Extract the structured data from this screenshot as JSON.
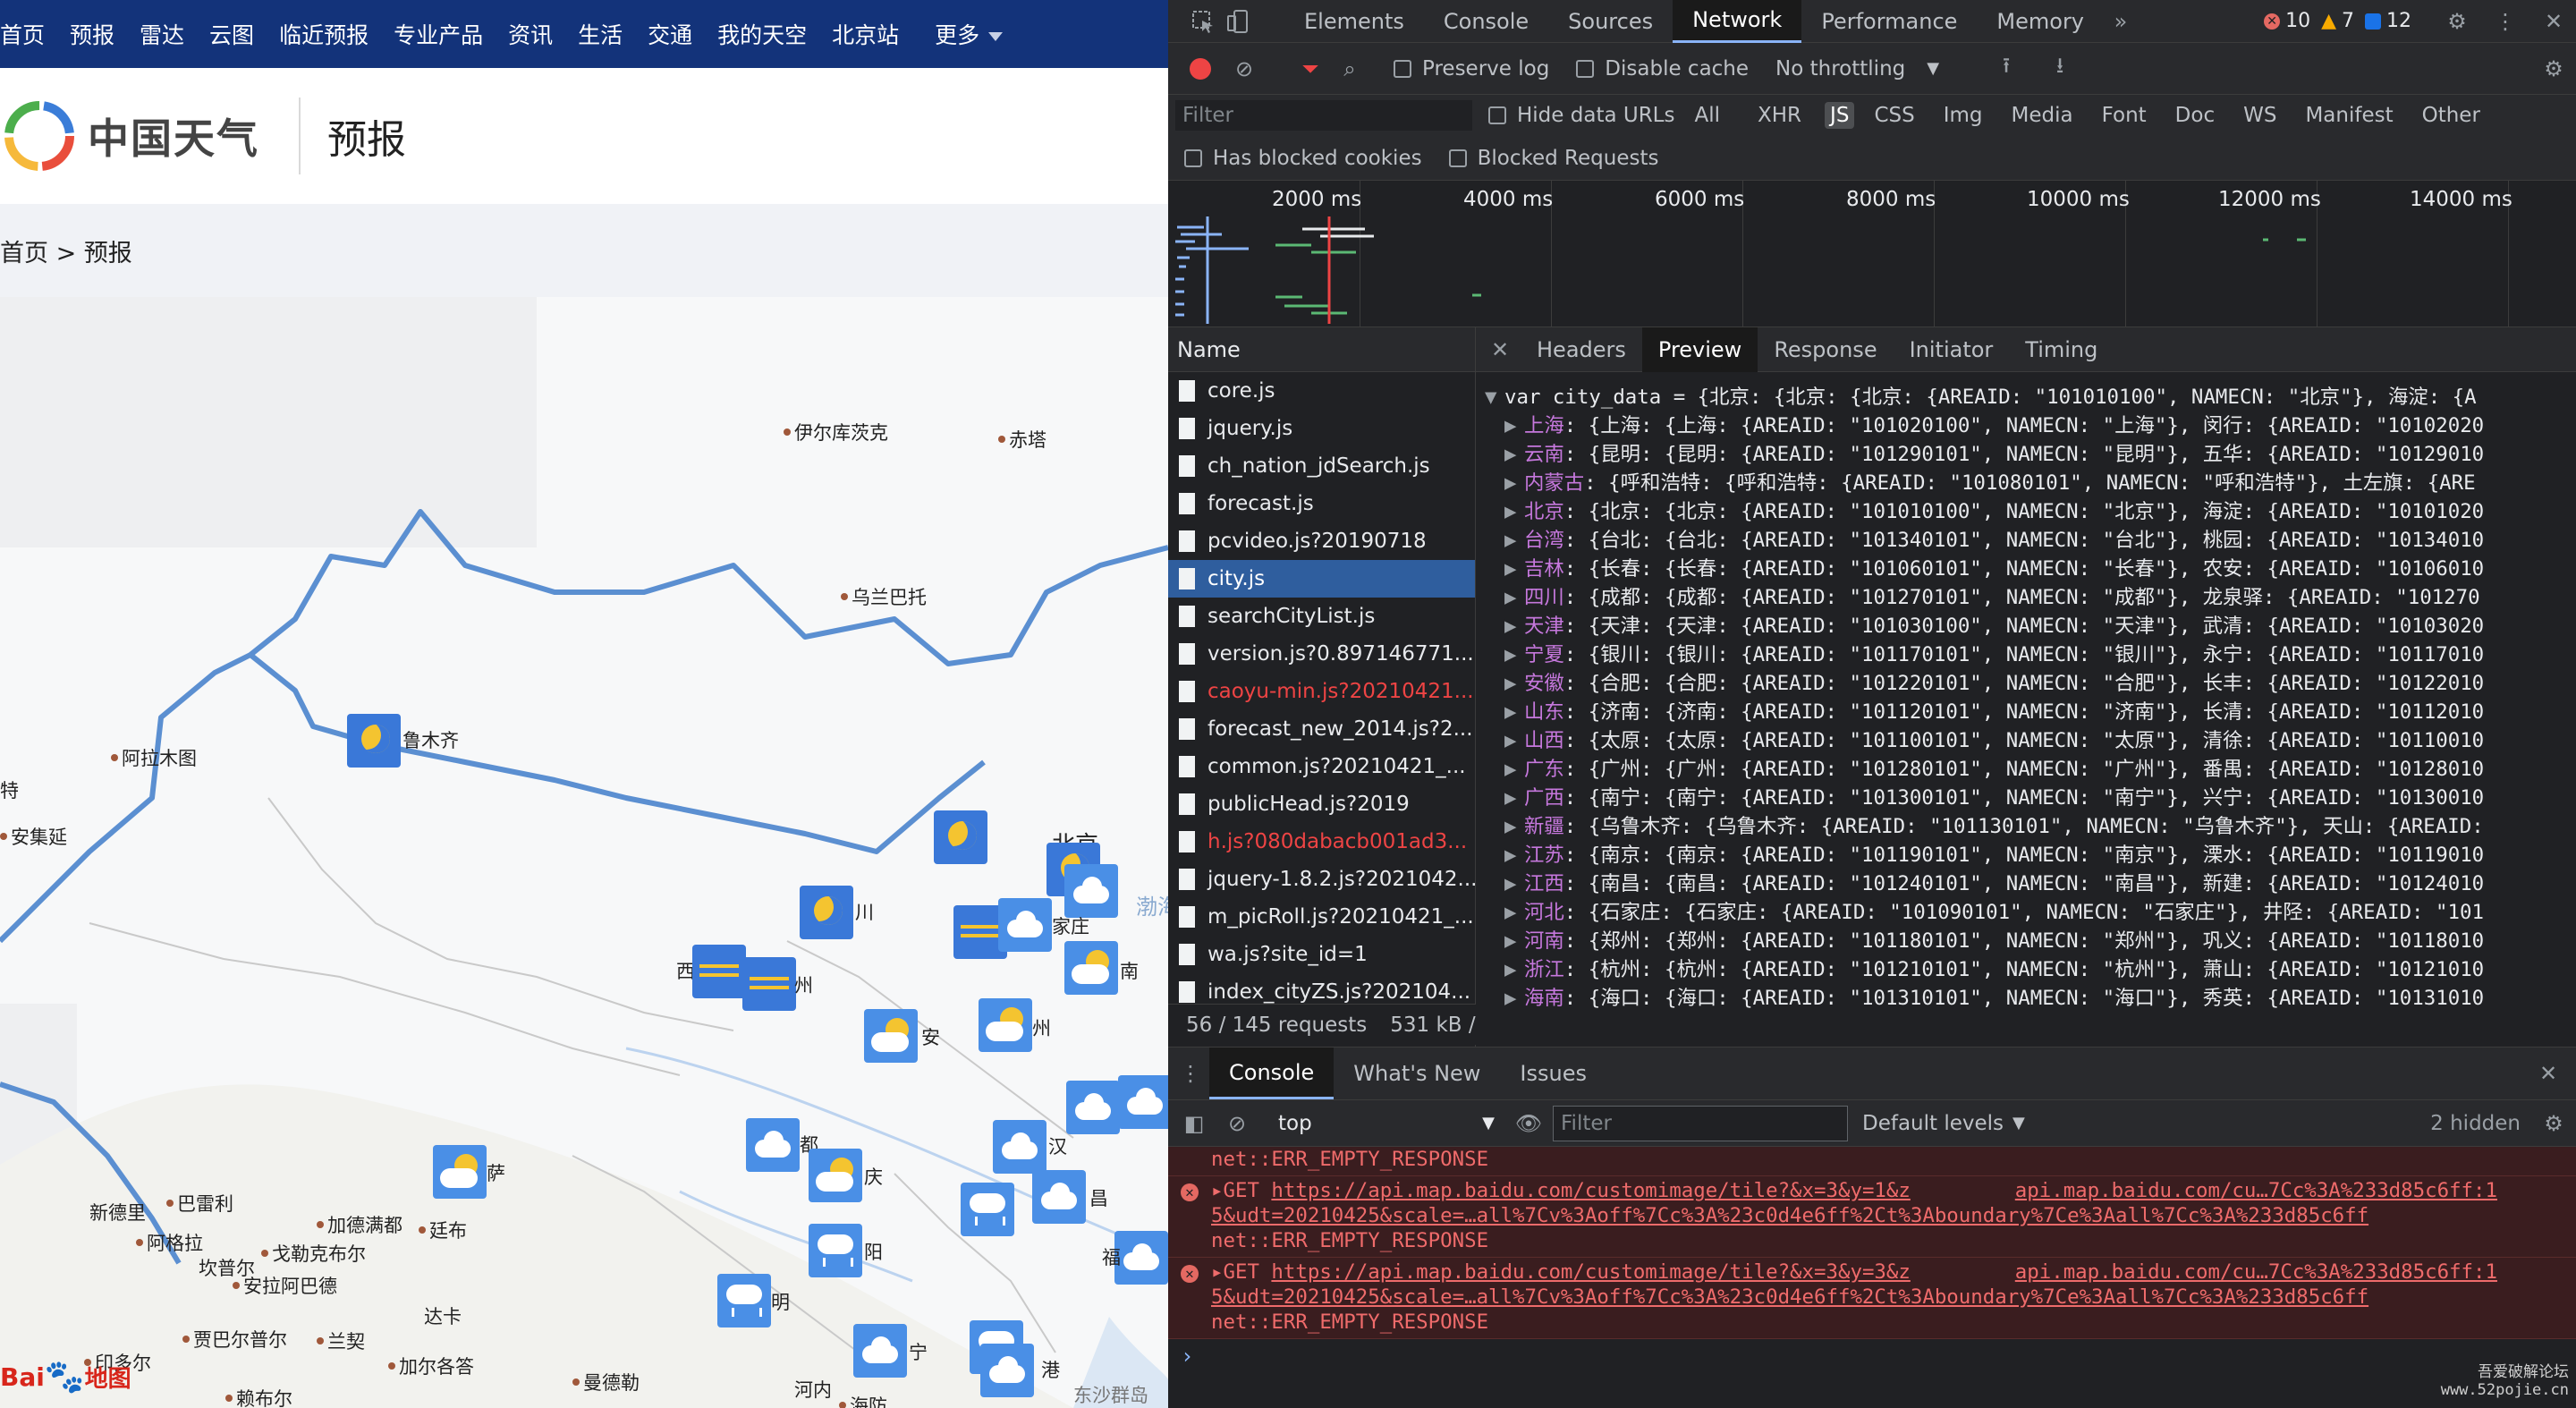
{
  "site": {
    "nav": [
      "首页",
      "预报",
      "雷达",
      "云图",
      "临近预报",
      "专业产品",
      "资讯",
      "生活",
      "交通",
      "我的天空",
      "北京站",
      "更多"
    ],
    "logo_text": "中国天气",
    "section": "预报",
    "breadcrumb": "首页 > 预报",
    "cities": [
      {
        "name": "伊尔库茨克",
        "icon": null
      },
      {
        "name": "赤塔",
        "icon": null
      },
      {
        "name": "乌兰巴托",
        "icon": null
      },
      {
        "name": "鲁木齐",
        "icon": "night"
      },
      {
        "name": "阿拉木图",
        "icon": null
      },
      {
        "name": "特",
        "icon": null
      },
      {
        "name": "安集延",
        "icon": null
      },
      {
        "name": "北京",
        "icon": "night"
      },
      {
        "name": "川",
        "icon": "night"
      },
      {
        "name": "家庄",
        "icon": "cloud"
      },
      {
        "name": "南",
        "icon": "sunc"
      },
      {
        "name": "西",
        "icon": "wind"
      },
      {
        "name": "州",
        "icon": "wind"
      },
      {
        "name": "安",
        "icon": "sunc"
      },
      {
        "name": "州",
        "icon": "sunc"
      },
      {
        "name": "萨",
        "icon": "sunc"
      },
      {
        "name": "都",
        "icon": "cloud"
      },
      {
        "name": "庆",
        "icon": "sunc"
      },
      {
        "name": "汉",
        "icon": "cloud"
      },
      {
        "name": "昌",
        "icon": "cloud"
      },
      {
        "name": "阳",
        "icon": "rain"
      },
      {
        "name": "明",
        "icon": "rain"
      },
      {
        "name": "宁",
        "icon": "cloud"
      },
      {
        "name": "港",
        "icon": "rain"
      },
      {
        "name": "福",
        "icon": "cloud"
      },
      {
        "name": "新德里",
        "icon": null
      },
      {
        "name": "巴雷利",
        "icon": null
      },
      {
        "name": "加德满都",
        "icon": null
      },
      {
        "name": "廷布",
        "icon": null
      },
      {
        "name": "阿格拉",
        "icon": null
      },
      {
        "name": "坎普尔",
        "icon": null
      },
      {
        "name": "戈勒克布尔",
        "icon": null
      },
      {
        "name": "安拉阿巴德",
        "icon": null
      },
      {
        "name": "达卡",
        "icon": null
      },
      {
        "name": "贾巴尔普尔",
        "icon": null
      },
      {
        "name": "兰契",
        "icon": null
      },
      {
        "name": "印多尔",
        "icon": null
      },
      {
        "name": "加尔各答",
        "icon": null
      },
      {
        "name": "曼德勒",
        "icon": null
      },
      {
        "name": "河内",
        "icon": null
      },
      {
        "name": "赖布尔",
        "icon": null
      },
      {
        "name": "海防",
        "icon": null
      },
      {
        "name": "东沙群岛",
        "icon": null
      },
      {
        "name": "渤海",
        "icon": null
      }
    ],
    "baidu_logo": "Bai",
    "baidu_logo2": "地图"
  },
  "devtools": {
    "tabs": [
      "Elements",
      "Console",
      "Sources",
      "Network",
      "Performance",
      "Memory"
    ],
    "active_tab": "Network",
    "errors": "10",
    "warnings": "7",
    "messages": "12",
    "toolbar": {
      "preserve_log": "Preserve log",
      "disable_cache": "Disable cache",
      "throttling": "No throttling"
    },
    "filter": {
      "placeholder": "Filter",
      "hide_data_urls": "Hide data URLs",
      "types": [
        "All",
        "XHR",
        "JS",
        "CSS",
        "Img",
        "Media",
        "Font",
        "Doc",
        "WS",
        "Manifest",
        "Other"
      ],
      "active_type": "JS",
      "has_blocked_cookies": "Has blocked cookies",
      "blocked_requests": "Blocked Requests"
    },
    "timeline_labels": [
      "2000 ms",
      "4000 ms",
      "6000 ms",
      "8000 ms",
      "10000 ms",
      "12000 ms",
      "14000 ms"
    ],
    "requests_header": "Name",
    "requests": [
      {
        "name": "core.js",
        "state": "normal"
      },
      {
        "name": "jquery.js",
        "state": "normal"
      },
      {
        "name": "ch_nation_jdSearch.js",
        "state": "normal"
      },
      {
        "name": "forecast.js",
        "state": "normal"
      },
      {
        "name": "pcvideo.js?20190718",
        "state": "normal"
      },
      {
        "name": "city.js",
        "state": "selected"
      },
      {
        "name": "searchCityList.js",
        "state": "normal"
      },
      {
        "name": "version.js?0.897146771...",
        "state": "normal"
      },
      {
        "name": "caoyu-min.js?20210421...",
        "state": "error"
      },
      {
        "name": "forecast_new_2014.js?2...",
        "state": "normal"
      },
      {
        "name": "common.js?20210421_...",
        "state": "normal"
      },
      {
        "name": "publicHead.js?2019",
        "state": "normal"
      },
      {
        "name": "h.js?080dabacb001ad3...",
        "state": "error"
      },
      {
        "name": "jquery-1.8.2.js?2021042...",
        "state": "normal"
      },
      {
        "name": "m_picRoll.js?20210421_...",
        "state": "normal"
      },
      {
        "name": "wa.js?site_id=1",
        "state": "normal"
      },
      {
        "name": "index_cityZS.js?202104...",
        "state": "normal"
      }
    ],
    "requests_status": "56 / 145 requests",
    "transferred": "531 kB /",
    "preview_tabs": [
      "Headers",
      "Preview",
      "Response",
      "Initiator",
      "Timing"
    ],
    "active_preview_tab": "Preview",
    "preview_first_line": "var city_data = {北京: {北京: {北京: {AREAID: \"101010100\", NAMECN: \"北京\"}, 海淀: {A",
    "preview_rows": [
      {
        "key": "上海",
        "rest": ": {上海: {上海: {AREAID: \"101020100\", NAMECN: \"上海\"}, 闵行: {AREAID: \"10102020"
      },
      {
        "key": "云南",
        "rest": ": {昆明: {昆明: {AREAID: \"101290101\", NAMECN: \"昆明\"}, 五华: {AREAID: \"10129010"
      },
      {
        "key": "内蒙古",
        "rest": ": {呼和浩特: {呼和浩特: {AREAID: \"101080101\", NAMECN: \"呼和浩特\"}, 土左旗: {ARE"
      },
      {
        "key": "北京",
        "rest": ": {北京: {北京: {AREAID: \"101010100\", NAMECN: \"北京\"}, 海淀: {AREAID: \"10101020"
      },
      {
        "key": "台湾",
        "rest": ": {台北: {台北: {AREAID: \"101340101\", NAMECN: \"台北\"}, 桃园: {AREAID: \"10134010"
      },
      {
        "key": "吉林",
        "rest": ": {长春: {长春: {AREAID: \"101060101\", NAMECN: \"长春\"}, 农安: {AREAID: \"10106010"
      },
      {
        "key": "四川",
        "rest": ": {成都: {成都: {AREAID: \"101270101\", NAMECN: \"成都\"}, 龙泉驿: {AREAID: \"101270"
      },
      {
        "key": "天津",
        "rest": ": {天津: {天津: {AREAID: \"101030100\", NAMECN: \"天津\"}, 武清: {AREAID: \"10103020"
      },
      {
        "key": "宁夏",
        "rest": ": {银川: {银川: {AREAID: \"101170101\", NAMECN: \"银川\"}, 永宁: {AREAID: \"10117010"
      },
      {
        "key": "安徽",
        "rest": ": {合肥: {合肥: {AREAID: \"101220101\", NAMECN: \"合肥\"}, 长丰: {AREAID: \"10122010"
      },
      {
        "key": "山东",
        "rest": ": {济南: {济南: {AREAID: \"101120101\", NAMECN: \"济南\"}, 长清: {AREAID: \"10112010"
      },
      {
        "key": "山西",
        "rest": ": {太原: {太原: {AREAID: \"101100101\", NAMECN: \"太原\"}, 清徐: {AREAID: \"10110010"
      },
      {
        "key": "广东",
        "rest": ": {广州: {广州: {AREAID: \"101280101\", NAMECN: \"广州\"}, 番禺: {AREAID: \"10128010"
      },
      {
        "key": "广西",
        "rest": ": {南宁: {南宁: {AREAID: \"101300101\", NAMECN: \"南宁\"}, 兴宁: {AREAID: \"10130010"
      },
      {
        "key": "新疆",
        "rest": ": {乌鲁木齐: {乌鲁木齐: {AREAID: \"101130101\", NAMECN: \"乌鲁木齐\"}, 天山: {AREAID:"
      },
      {
        "key": "江苏",
        "rest": ": {南京: {南京: {AREAID: \"101190101\", NAMECN: \"南京\"}, 溧水: {AREAID: \"10119010"
      },
      {
        "key": "江西",
        "rest": ": {南昌: {南昌: {AREAID: \"101240101\", NAMECN: \"南昌\"}, 新建: {AREAID: \"10124010"
      },
      {
        "key": "河北",
        "rest": ": {石家庄: {石家庄: {AREAID: \"101090101\", NAMECN: \"石家庄\"}, 井陉: {AREAID: \"101"
      },
      {
        "key": "河南",
        "rest": ": {郑州: {郑州: {AREAID: \"101180101\", NAMECN: \"郑州\"}, 巩义: {AREAID: \"10118010"
      },
      {
        "key": "浙江",
        "rest": ": {杭州: {杭州: {AREAID: \"101210101\", NAMECN: \"杭州\"}, 萧山: {AREAID: \"10121010"
      },
      {
        "key": "海南",
        "rest": ": {海口: {海口: {AREAID: \"101310101\", NAMECN: \"海口\"}, 秀英: {AREAID: \"10131010"
      }
    ],
    "drawer_tabs": [
      "Console",
      "What's New",
      "Issues"
    ],
    "active_drawer_tab": "Console",
    "context": "top",
    "console_filter_placeholder": "Filter",
    "levels": "Default levels",
    "hidden": "2 hidden",
    "console_messages": [
      {
        "pre": "",
        "url": "",
        "url_right": "",
        "line2": "",
        "line3": "net::ERR_EMPTY_RESPONSE"
      },
      {
        "pre": "▸GET ",
        "url": "https://api.map.baidu.com/customimage/tile?&x=3&y=1&z",
        "url_right": "api.map.baidu.com/cu…7Cc%3A%233d85c6ff:1",
        "line2": "5&udt=20210425&scale=…all%7Cv%3Aoff%7Cc%3A%23c0d4e6ff%2Ct%3Aboundary%7Ce%3Aall%7Cc%3A%233d85c6ff",
        "line3": "net::ERR_EMPTY_RESPONSE"
      },
      {
        "pre": "▸GET ",
        "url": "https://api.map.baidu.com/customimage/tile?&x=3&y=3&z",
        "url_right": "api.map.baidu.com/cu…7Cc%3A%233d85c6ff:1",
        "line2": "5&udt=20210425&scale=…all%7Cv%3Aoff%7Cc%3A%23c0d4e6ff%2Ct%3Aboundary%7Ce%3Aall%7Cc%3A%233d85c6ff",
        "line3": "net::ERR_EMPTY_RESPONSE"
      }
    ],
    "watermark": [
      "吾爱破解论坛",
      "www.52pojie.cn"
    ]
  }
}
